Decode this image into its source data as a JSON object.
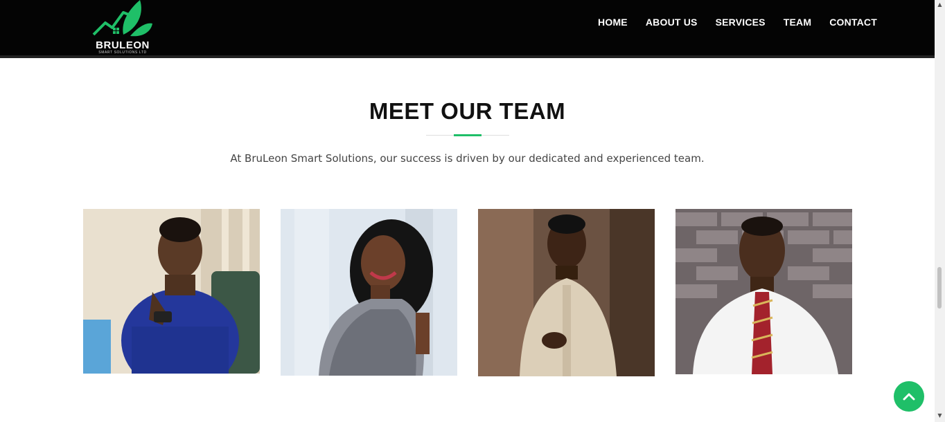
{
  "brand": {
    "name": "BRULEON",
    "tagline": "SMART SOLUTIONS LTD",
    "accent_color": "#1fbf68"
  },
  "nav": {
    "items": [
      {
        "label": "HOME"
      },
      {
        "label": "ABOUT US"
      },
      {
        "label": "SERVICES"
      },
      {
        "label": "TEAM"
      },
      {
        "label": "CONTACT"
      }
    ]
  },
  "team_section": {
    "title": "MEET OUR TEAM",
    "subtitle": "At BruLeon Smart Solutions, our success is driven by our dedicated and experienced team.",
    "members": [
      {
        "photo": "team-member-photo-1"
      },
      {
        "photo": "team-member-photo-2"
      },
      {
        "photo": "team-member-photo-3"
      },
      {
        "photo": "team-member-photo-4"
      }
    ]
  },
  "controls": {
    "scroll_top_icon": "chevron-up-icon"
  }
}
